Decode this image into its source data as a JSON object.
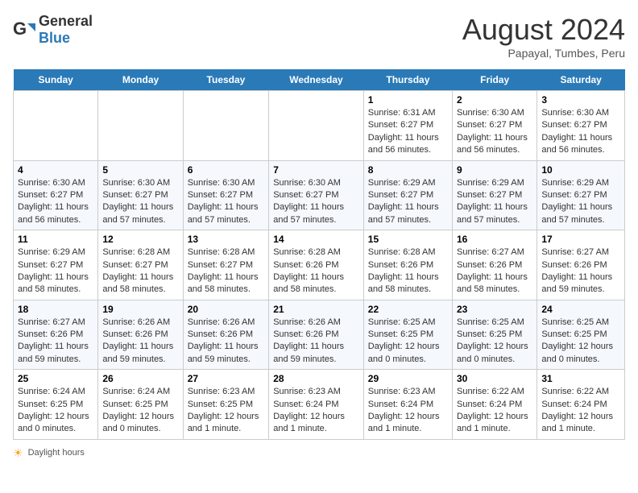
{
  "header": {
    "logo_general": "General",
    "logo_blue": "Blue",
    "title": "August 2024",
    "subtitle": "Papayal, Tumbes, Peru"
  },
  "days_of_week": [
    "Sunday",
    "Monday",
    "Tuesday",
    "Wednesday",
    "Thursday",
    "Friday",
    "Saturday"
  ],
  "weeks": [
    [
      {
        "day": "",
        "content": ""
      },
      {
        "day": "",
        "content": ""
      },
      {
        "day": "",
        "content": ""
      },
      {
        "day": "",
        "content": ""
      },
      {
        "day": "1",
        "content": "Sunrise: 6:31 AM\nSunset: 6:27 PM\nDaylight: 11 hours and 56 minutes."
      },
      {
        "day": "2",
        "content": "Sunrise: 6:30 AM\nSunset: 6:27 PM\nDaylight: 11 hours and 56 minutes."
      },
      {
        "day": "3",
        "content": "Sunrise: 6:30 AM\nSunset: 6:27 PM\nDaylight: 11 hours and 56 minutes."
      }
    ],
    [
      {
        "day": "4",
        "content": "Sunrise: 6:30 AM\nSunset: 6:27 PM\nDaylight: 11 hours and 56 minutes."
      },
      {
        "day": "5",
        "content": "Sunrise: 6:30 AM\nSunset: 6:27 PM\nDaylight: 11 hours and 57 minutes."
      },
      {
        "day": "6",
        "content": "Sunrise: 6:30 AM\nSunset: 6:27 PM\nDaylight: 11 hours and 57 minutes."
      },
      {
        "day": "7",
        "content": "Sunrise: 6:30 AM\nSunset: 6:27 PM\nDaylight: 11 hours and 57 minutes."
      },
      {
        "day": "8",
        "content": "Sunrise: 6:29 AM\nSunset: 6:27 PM\nDaylight: 11 hours and 57 minutes."
      },
      {
        "day": "9",
        "content": "Sunrise: 6:29 AM\nSunset: 6:27 PM\nDaylight: 11 hours and 57 minutes."
      },
      {
        "day": "10",
        "content": "Sunrise: 6:29 AM\nSunset: 6:27 PM\nDaylight: 11 hours and 57 minutes."
      }
    ],
    [
      {
        "day": "11",
        "content": "Sunrise: 6:29 AM\nSunset: 6:27 PM\nDaylight: 11 hours and 58 minutes."
      },
      {
        "day": "12",
        "content": "Sunrise: 6:28 AM\nSunset: 6:27 PM\nDaylight: 11 hours and 58 minutes."
      },
      {
        "day": "13",
        "content": "Sunrise: 6:28 AM\nSunset: 6:27 PM\nDaylight: 11 hours and 58 minutes."
      },
      {
        "day": "14",
        "content": "Sunrise: 6:28 AM\nSunset: 6:26 PM\nDaylight: 11 hours and 58 minutes."
      },
      {
        "day": "15",
        "content": "Sunrise: 6:28 AM\nSunset: 6:26 PM\nDaylight: 11 hours and 58 minutes."
      },
      {
        "day": "16",
        "content": "Sunrise: 6:27 AM\nSunset: 6:26 PM\nDaylight: 11 hours and 58 minutes."
      },
      {
        "day": "17",
        "content": "Sunrise: 6:27 AM\nSunset: 6:26 PM\nDaylight: 11 hours and 59 minutes."
      }
    ],
    [
      {
        "day": "18",
        "content": "Sunrise: 6:27 AM\nSunset: 6:26 PM\nDaylight: 11 hours and 59 minutes."
      },
      {
        "day": "19",
        "content": "Sunrise: 6:26 AM\nSunset: 6:26 PM\nDaylight: 11 hours and 59 minutes."
      },
      {
        "day": "20",
        "content": "Sunrise: 6:26 AM\nSunset: 6:26 PM\nDaylight: 11 hours and 59 minutes."
      },
      {
        "day": "21",
        "content": "Sunrise: 6:26 AM\nSunset: 6:26 PM\nDaylight: 11 hours and 59 minutes."
      },
      {
        "day": "22",
        "content": "Sunrise: 6:25 AM\nSunset: 6:25 PM\nDaylight: 12 hours and 0 minutes."
      },
      {
        "day": "23",
        "content": "Sunrise: 6:25 AM\nSunset: 6:25 PM\nDaylight: 12 hours and 0 minutes."
      },
      {
        "day": "24",
        "content": "Sunrise: 6:25 AM\nSunset: 6:25 PM\nDaylight: 12 hours and 0 minutes."
      }
    ],
    [
      {
        "day": "25",
        "content": "Sunrise: 6:24 AM\nSunset: 6:25 PM\nDaylight: 12 hours and 0 minutes."
      },
      {
        "day": "26",
        "content": "Sunrise: 6:24 AM\nSunset: 6:25 PM\nDaylight: 12 hours and 0 minutes."
      },
      {
        "day": "27",
        "content": "Sunrise: 6:23 AM\nSunset: 6:25 PM\nDaylight: 12 hours and 1 minute."
      },
      {
        "day": "28",
        "content": "Sunrise: 6:23 AM\nSunset: 6:24 PM\nDaylight: 12 hours and 1 minute."
      },
      {
        "day": "29",
        "content": "Sunrise: 6:23 AM\nSunset: 6:24 PM\nDaylight: 12 hours and 1 minute."
      },
      {
        "day": "30",
        "content": "Sunrise: 6:22 AM\nSunset: 6:24 PM\nDaylight: 12 hours and 1 minute."
      },
      {
        "day": "31",
        "content": "Sunrise: 6:22 AM\nSunset: 6:24 PM\nDaylight: 12 hours and 1 minute."
      }
    ]
  ],
  "legend": {
    "daylight_hours": "Daylight hours"
  }
}
